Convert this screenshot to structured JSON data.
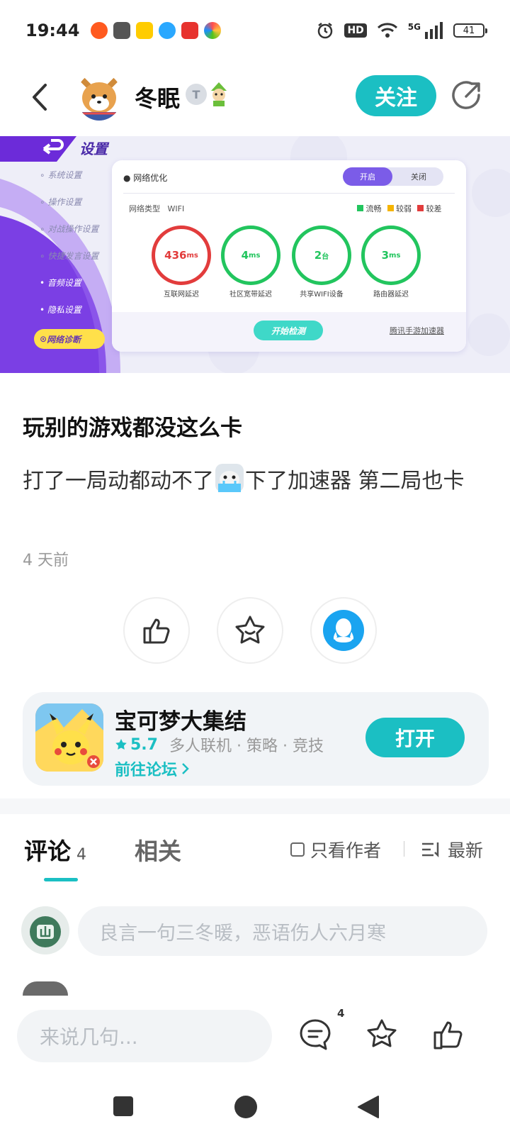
{
  "status_bar": {
    "time": "19:44",
    "hd": "HD",
    "network": "5G",
    "battery": "41",
    "icons": [
      "notification-app-icon",
      "robot-app-icon",
      "meituan-icon",
      "search-app-icon",
      "game-app-icon",
      "color-app-icon",
      "alarm-icon",
      "wifi-icon",
      "signal-icon"
    ]
  },
  "header": {
    "author_name": "冬眠",
    "level_badge": "T",
    "follow_label": "关注"
  },
  "banner": {
    "settings_title": "设置",
    "menu": [
      "系统设置",
      "操作设置",
      "对战操作设置",
      "快捷发言设置",
      "音频设置",
      "隐私设置",
      "网络诊断"
    ],
    "panel_title": "网络优化",
    "toggle_on": "开启",
    "toggle_off": "关闭",
    "network_type_label": "网络类型",
    "network_type_value": "WIFI",
    "legend": [
      "流畅",
      "较弱",
      "较差"
    ],
    "metrics": [
      {
        "value": "436",
        "unit": "ms",
        "label": "互联网延迟"
      },
      {
        "value": "4",
        "unit": "ms",
        "label": "社区宽带延迟"
      },
      {
        "value": "2",
        "unit": "台",
        "label": "共享WIFI设备"
      },
      {
        "value": "3",
        "unit": "ms",
        "label": "路由器延迟"
      }
    ],
    "start_button": "开始检测",
    "accelerator_link": "腾讯手游加速器"
  },
  "post": {
    "title": "玩别的游戏都没这么卡",
    "body_part1": "打了一局动都动不了",
    "body_part2": "下了加速器 第二局也卡",
    "time": "4 天前"
  },
  "game_card": {
    "name": "宝可梦大集结",
    "rating": "5.7",
    "tags": "多人联机 · 策略 · 竞技",
    "forum_link": "前往论坛",
    "open_label": "打开"
  },
  "tabs": {
    "comments_label": "评论",
    "comments_count": "4",
    "related_label": "相关",
    "author_only": "只看作者",
    "sort": "最新"
  },
  "comment_input": {
    "placeholder": "良言一句三冬暖，恶语伤人六月寒"
  },
  "bottom_bar": {
    "placeholder": "来说几句...",
    "comment_count": "4"
  },
  "colors": {
    "accent": "#1bbfc3",
    "red": "#e23c3c",
    "green": "#22c55e",
    "purple": "#7b3fe4"
  }
}
